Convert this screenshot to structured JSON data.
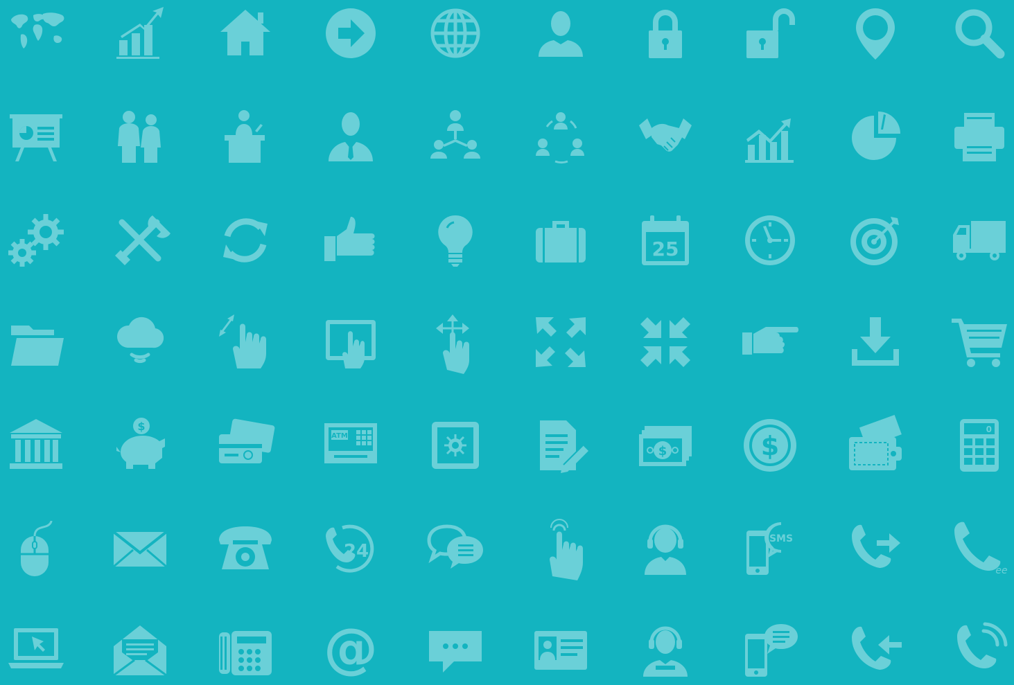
{
  "palette": {
    "background": "#13b4c0",
    "icon": "#6ad0d8",
    "cutout": "#13b4c0"
  },
  "rows": [
    [
      "world-map-icon",
      "growth-chart-icon",
      "home-icon",
      "arrow-right-circle-icon",
      "globe-icon",
      "user-icon",
      "lock-icon",
      "unlock-icon",
      "map-pin-icon",
      "search-icon"
    ],
    [
      "presentation-board-icon",
      "business-team-icon",
      "speaker-podium-icon",
      "businessman-icon",
      "org-hierarchy-icon",
      "team-cycle-icon",
      "handshake-icon",
      "trend-chart-icon",
      "pie-chart-icon",
      "printer-icon"
    ],
    [
      "gears-icon",
      "tools-icon",
      "refresh-icon",
      "thumbs-up-icon",
      "lightbulb-icon",
      "briefcase-icon",
      "calendar-icon",
      "clock-icon",
      "target-icon",
      "truck-icon"
    ],
    [
      "folder-icon",
      "cloud-signal-icon",
      "pinch-gesture-icon",
      "tablet-touch-icon",
      "drag-gesture-icon",
      "expand-icon",
      "collapse-icon",
      "pointing-hand-icon",
      "download-icon",
      "shopping-cart-icon"
    ],
    [
      "bank-icon",
      "piggy-bank-icon",
      "credit-cards-icon",
      "atm-icon",
      "safe-icon",
      "document-sign-icon",
      "banknotes-icon",
      "dollar-coin-icon",
      "wallet-icon",
      "calculator-icon"
    ],
    [
      "mouse-icon",
      "envelope-icon",
      "rotary-phone-icon",
      "support-24-icon",
      "chat-bubbles-icon",
      "tap-finger-icon",
      "call-center-agent-icon",
      "sms-phone-icon",
      "call-forward-icon",
      "phone-receiver-icon"
    ],
    [
      "laptop-icon",
      "open-envelope-icon",
      "fax-phone-icon",
      "at-sign-icon",
      "speech-bubble-icon",
      "id-card-icon",
      "headset-agent-icon",
      "mobile-chat-icon",
      "call-incoming-icon",
      "phone-ringing-icon"
    ]
  ],
  "labels": {
    "calendar_day": "25",
    "atm_text": "ATM",
    "dollar_sign": "$",
    "sms_text": "SMS",
    "support_hours": "24",
    "at_sign": "@",
    "calculator_display": "0",
    "mouse_trail": "ee"
  }
}
